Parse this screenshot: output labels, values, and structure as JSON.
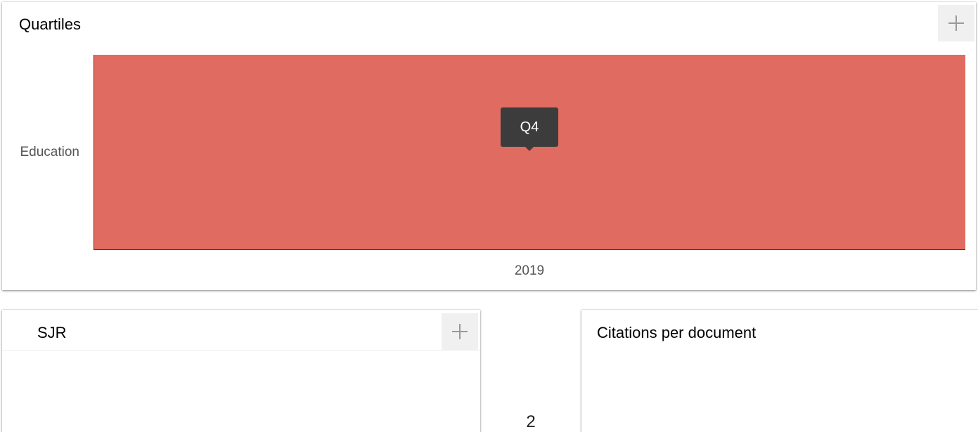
{
  "quartiles": {
    "title": "Quartiles",
    "expand_label": "+"
  },
  "chart_data": {
    "type": "heatmap",
    "categories": [
      "2019"
    ],
    "rows": [
      "Education"
    ],
    "values": [
      [
        "Q4"
      ]
    ],
    "title": "Quartiles",
    "xlabel": "",
    "ylabel": "",
    "colors": {
      "Q4": "#e06b60"
    },
    "tooltip": "Q4"
  },
  "sjr": {
    "title": "SJR",
    "expand_label": "+"
  },
  "middle_value": "2",
  "citations": {
    "title": "Citations per document"
  },
  "colors": {
    "q4_red": "#e06b60",
    "tooltip_bg": "#3c3c3c",
    "button_bg": "#f0f0f0"
  }
}
